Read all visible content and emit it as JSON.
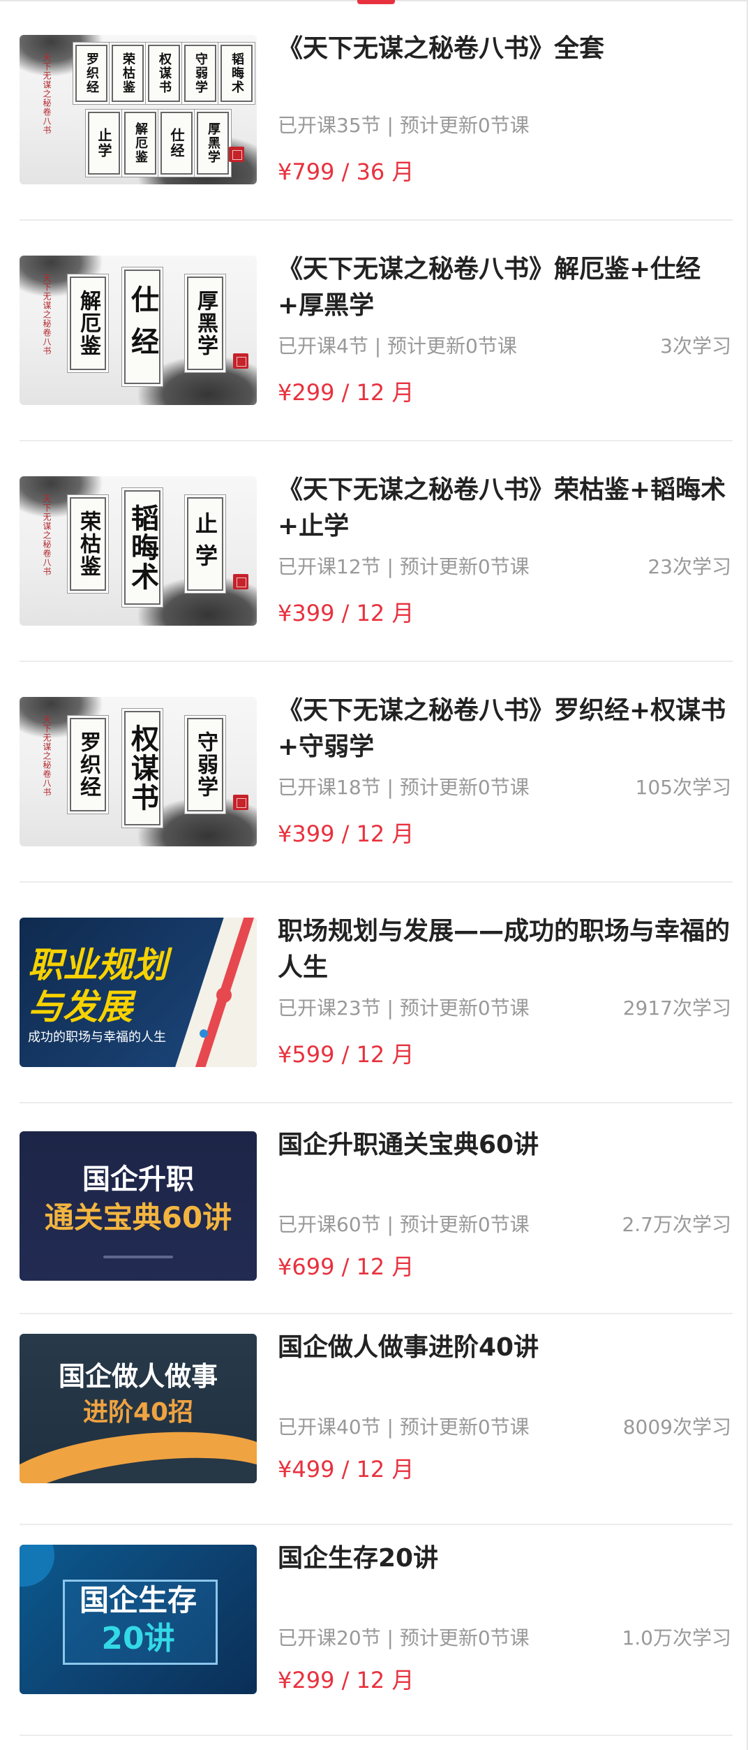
{
  "courses": [
    {
      "title": "《天下无谋之秘卷八书》全套",
      "lessons": "已开课35节 | 预计更新0节课",
      "learners": "",
      "price": "¥799 / 36 月",
      "thumb": {
        "side_title": "天下无谋之秘卷八书",
        "scrolls": [
          "罗织经",
          "荣枯鉴",
          "权谋书",
          "守弱学",
          "韬晦术",
          "止学",
          "解厄鉴",
          "仕经",
          "厚黑学"
        ]
      }
    },
    {
      "title": "《天下无谋之秘卷八书》解厄鉴+仕经+厚黑学",
      "lessons": "已开课4节 | 预计更新0节课",
      "learners": "3次学习",
      "price": "¥299 / 12 月",
      "thumb": {
        "side_title": "天下无谋之秘卷八书",
        "scrolls": [
          "解厄鉴",
          "仕经",
          "厚黑学"
        ]
      }
    },
    {
      "title": "《天下无谋之秘卷八书》荣枯鉴+韬晦术+止学",
      "lessons": "已开课12节 | 预计更新0节课",
      "learners": "23次学习",
      "price": "¥399 / 12 月",
      "thumb": {
        "side_title": "天下无谋之秘卷八书",
        "scrolls": [
          "荣枯鉴",
          "韬晦术",
          "止学"
        ]
      }
    },
    {
      "title": "《天下无谋之秘卷八书》罗织经+权谋书+守弱学",
      "lessons": "已开课18节 | 预计更新0节课",
      "learners": "105次学习",
      "price": "¥399 / 12 月",
      "thumb": {
        "side_title": "天下无谋之秘卷八书",
        "scrolls": [
          "罗织经",
          "权谋书",
          "守弱学"
        ]
      }
    },
    {
      "title": "职场规划与发展——成功的职场与幸福的人生",
      "lessons": "已开课23节 | 预计更新0节课",
      "learners": "2917次学习",
      "price": "¥599 / 12 月",
      "thumb": {
        "line1": "职业规划",
        "line2": "与发展",
        "line3": "成功的职场与幸福的人生"
      }
    },
    {
      "title": "国企升职通关宝典60讲",
      "lessons": "已开课60节 | 预计更新0节课",
      "learners": "2.7万次学习",
      "price": "¥699 / 12 月",
      "thumb": {
        "line1": "国企升职",
        "line2": "通关宝典60讲"
      }
    },
    {
      "title": "国企做人做事进阶40讲",
      "lessons": "已开课40节 | 预计更新0节课",
      "learners": "8009次学习",
      "price": "¥499 / 12 月",
      "thumb": {
        "line1": "国企做人做事",
        "line2": "进阶40招"
      }
    },
    {
      "title": "国企生存20讲",
      "lessons": "已开课20节 | 预计更新0节课",
      "learners": "1.0万次学习",
      "price": "¥299 / 12 月",
      "thumb": {
        "line1": "国企生存",
        "line2": "20讲"
      }
    }
  ],
  "colors": {
    "accent": "#e8313e",
    "muted_text": "#999999",
    "title_text": "#222222"
  }
}
